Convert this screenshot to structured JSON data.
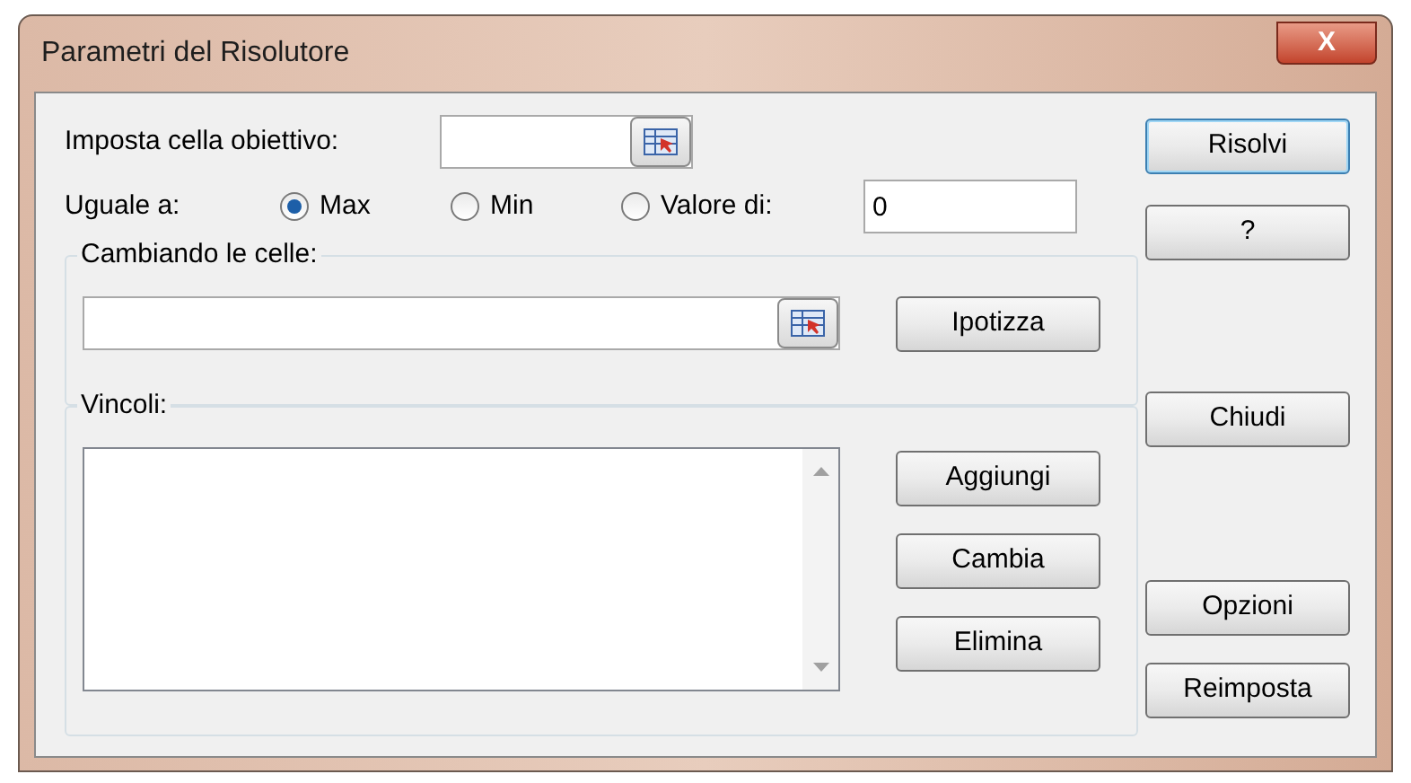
{
  "window": {
    "title": "Parametri del Risolutore",
    "close": "X"
  },
  "objective": {
    "label": "Imposta cella obiettivo:"
  },
  "equal_to": {
    "label": "Uguale a:",
    "options": [
      {
        "label": "Max",
        "selected": true
      },
      {
        "label": "Min",
        "selected": false
      },
      {
        "label": "Valore di:",
        "selected": false
      }
    ],
    "value": "0"
  },
  "changing_cells": {
    "label": "Cambiando le celle:",
    "button": "Ipotizza"
  },
  "constraints": {
    "label": "Vincoli:",
    "buttons": [
      "Aggiungi",
      "Cambia",
      "Elimina"
    ]
  },
  "side_buttons": [
    {
      "label": "Risolvi",
      "default": true
    },
    {
      "label": "?",
      "default": false
    },
    {
      "label": "Chiudi",
      "default": false
    },
    {
      "label": "Opzioni",
      "default": false
    },
    {
      "label": "Reimposta",
      "default": false
    }
  ]
}
